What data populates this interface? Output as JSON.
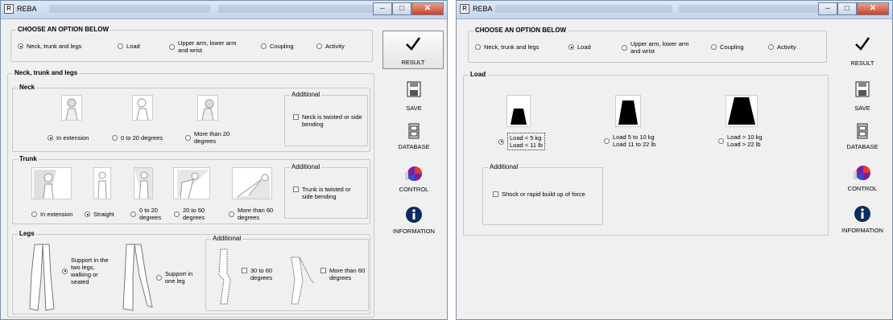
{
  "left_window": {
    "title": "REBA",
    "options_group": {
      "label": "CHOOSE AN OPTION BELOW",
      "options": [
        "Neck, trunk and legs",
        "Load",
        "Upper arm, lower arm and wrist",
        "Coupling",
        "Activity"
      ],
      "selected": "Neck, trunk and legs"
    },
    "section_label": "Neck, trunk and legs",
    "neck": {
      "label": "Neck",
      "options": [
        "In extension",
        "0 to 20 degrees",
        "More than 20 degrees"
      ],
      "selected": "In extension",
      "additional_label": "Additional",
      "additional_check": "Neck is twisted or side bending"
    },
    "trunk": {
      "label": "Trunk",
      "options": [
        "In extension",
        "Straight",
        "0 to 20 degrees",
        "20 to 60 degrees",
        "More than 60 degrees"
      ],
      "selected": "Straight",
      "additional_label": "Additional",
      "additional_check": "Trunk is twisted or side bending"
    },
    "legs": {
      "label": "Legs",
      "options": [
        "Support in the two legs, walking or seated",
        "Support in one leg"
      ],
      "selected": "Support in the two legs, walking or seated",
      "additional_label": "Additional",
      "checks": [
        "30 to 60 degrees",
        "More than 60 degrees"
      ]
    },
    "buttons": {
      "result": "RESULT",
      "save": "SAVE",
      "database": "DATABASE",
      "control": "CONTROL",
      "information": "INFORMATION"
    }
  },
  "right_window": {
    "title": "REBA",
    "options_group": {
      "label": "CHOOSE AN OPTION BELOW",
      "options": [
        "Neck, trunk and legs",
        "Load",
        "Upper arm, lower arm and wrist",
        "Coupling",
        "Activity"
      ],
      "selected": "Load"
    },
    "load": {
      "label": "Load",
      "options": [
        {
          "line1": "Load < 5 kg",
          "line2": "Load < 11 lb"
        },
        {
          "line1": "Load 5 to 10 kg",
          "line2": "Load 11 to 22 lb"
        },
        {
          "line1": "Load > 10 kg",
          "line2": "Load > 22 lb"
        }
      ],
      "selected": 0,
      "additional_label": "Additional",
      "additional_check": "Shock or rapid build up of force"
    },
    "buttons": {
      "result": "RESULT",
      "save": "SAVE",
      "database": "DATABASE",
      "control": "CONTROL",
      "information": "INFORMATION"
    }
  },
  "colors": {
    "titlebar": "#c9d9ee",
    "window_bg": "#f0f0f0",
    "close_button": "#c8432b",
    "information_icon": "#0b2c5c"
  }
}
